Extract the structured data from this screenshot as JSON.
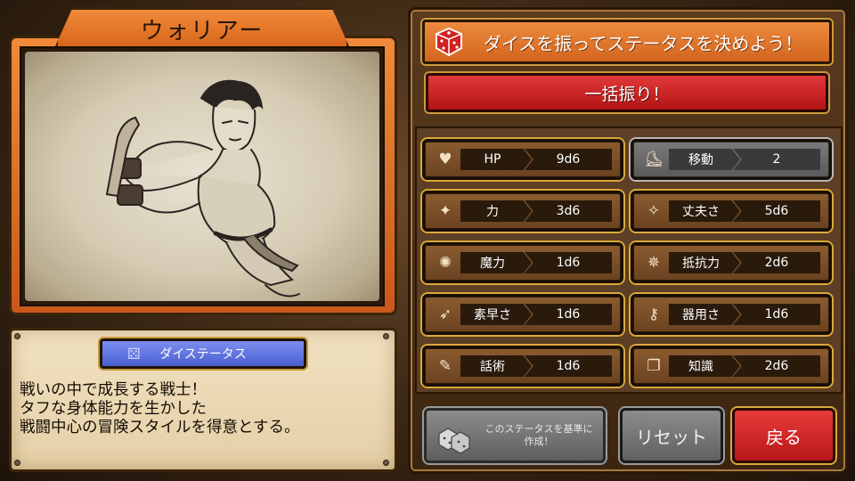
{
  "character": {
    "class_name": "ウォリアー",
    "description_lines": [
      "戦いの中で成長する戦士！",
      "タフな身体能力を生かした",
      "戦闘中心の冒険スタイルを得意とする。"
    ]
  },
  "dice_status_button": {
    "label": "ダイステータス",
    "icon": "dice-icon"
  },
  "banner": {
    "text": "ダイスを振ってステータスを決めよう！",
    "icon": "dice-icon"
  },
  "roll_all": {
    "label": "一括振り！"
  },
  "stats": [
    {
      "name": "HP",
      "value": "9d6",
      "icon": "heart-icon",
      "style": "brown"
    },
    {
      "name": "移動",
      "value": "2",
      "icon": "boot-icon",
      "style": "gray"
    },
    {
      "name": "力",
      "value": "3d6",
      "icon": "strength-icon",
      "style": "brown"
    },
    {
      "name": "丈夫さ",
      "value": "5d6",
      "icon": "toughness-icon",
      "style": "brown"
    },
    {
      "name": "魔力",
      "value": "1d6",
      "icon": "magic-icon",
      "style": "brown"
    },
    {
      "name": "抵抗力",
      "value": "2d6",
      "icon": "resistance-icon",
      "style": "brown"
    },
    {
      "name": "素早さ",
      "value": "1d6",
      "icon": "speed-icon",
      "style": "brown"
    },
    {
      "name": "器用さ",
      "value": "1d6",
      "icon": "dexterity-icon",
      "style": "brown"
    },
    {
      "name": "話術",
      "value": "1d6",
      "icon": "speech-icon",
      "style": "brown"
    },
    {
      "name": "知識",
      "value": "2d6",
      "icon": "book-icon",
      "style": "brown"
    }
  ],
  "buttons": {
    "create_line1": "このステータスを基準に",
    "create_line2": "作成！",
    "reset": "リセット",
    "back": "戻る"
  },
  "colors": {
    "orange": "#e57a2c",
    "red_button": "#c82020",
    "blue_button": "#5a6fe0",
    "gold_border": "#d9a83a",
    "stat_brown": "#7a4e28"
  }
}
